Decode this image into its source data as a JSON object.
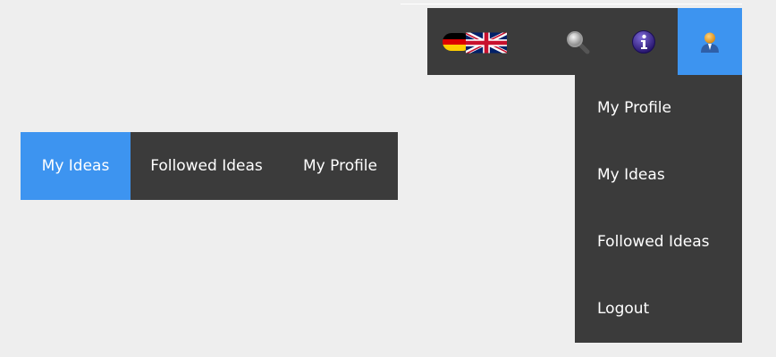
{
  "header": {
    "languages": [
      {
        "name": "german-flag-icon",
        "code": "de"
      },
      {
        "name": "uk-flag-icon",
        "code": "en"
      }
    ],
    "icons": [
      "search-icon",
      "info-icon",
      "user-icon"
    ],
    "active_color": "#3d94f0",
    "bar_color": "#3b3b3b"
  },
  "user_menu": {
    "items": [
      {
        "label": "My Profile"
      },
      {
        "label": "My Ideas"
      },
      {
        "label": "Followed Ideas"
      },
      {
        "label": "Logout"
      }
    ]
  },
  "tabs": {
    "items": [
      {
        "label": "My Ideas",
        "active": true
      },
      {
        "label": "Followed Ideas",
        "active": false
      },
      {
        "label": "My Profile",
        "active": false
      }
    ]
  }
}
